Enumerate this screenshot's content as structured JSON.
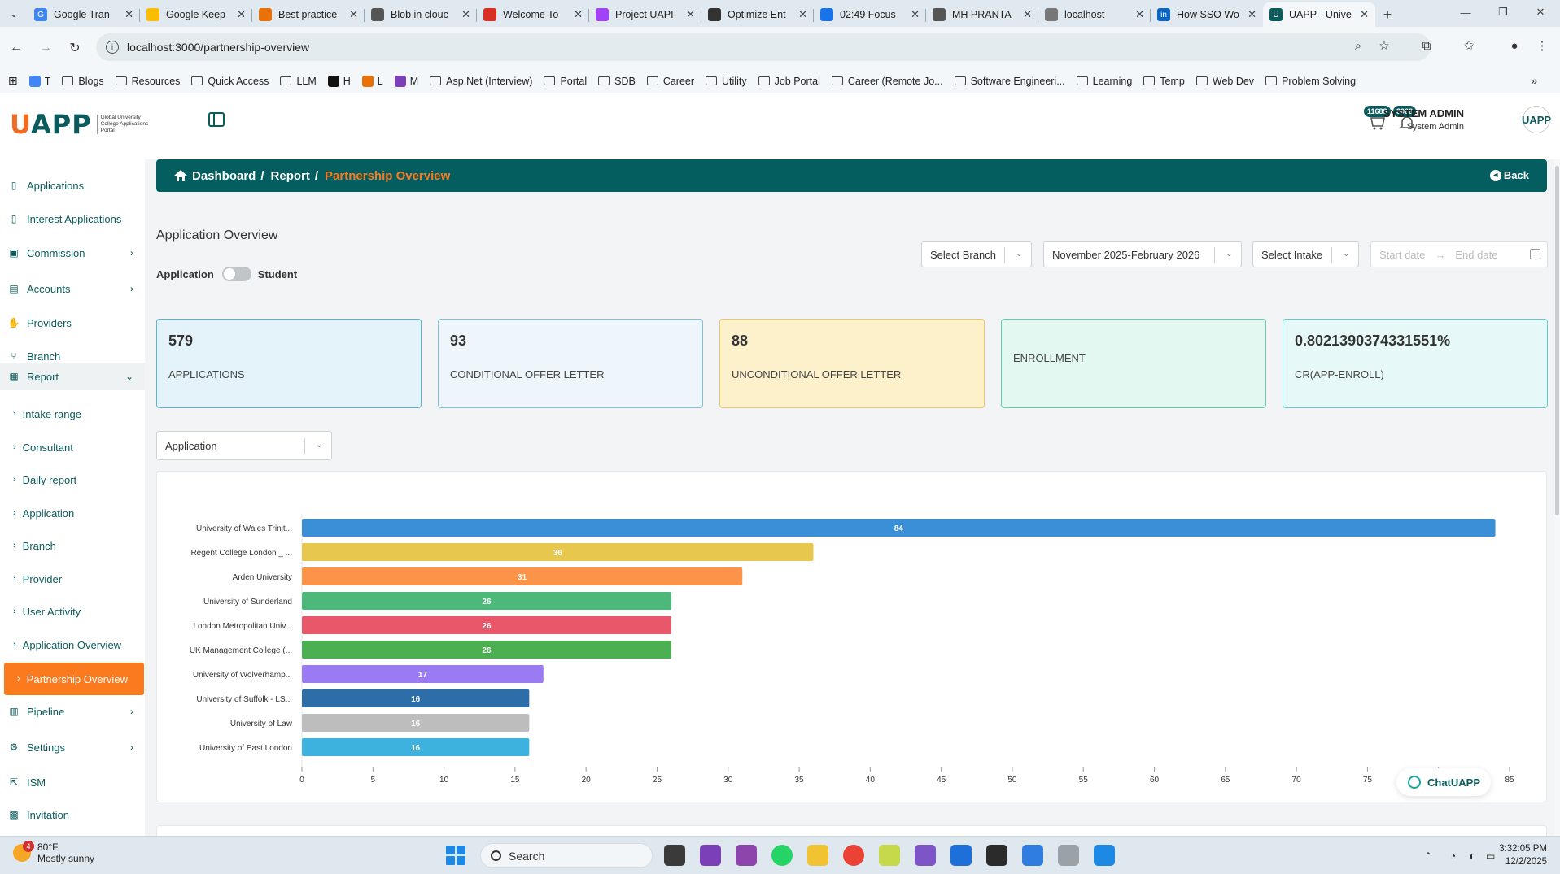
{
  "browser": {
    "tabs": [
      {
        "label": "Google Tran",
        "color": "#4285f4",
        "glyph": "G"
      },
      {
        "label": "Google Keep",
        "color": "#fbbc04",
        "glyph": ""
      },
      {
        "label": "Best practice",
        "color": "#e8710a",
        "glyph": ""
      },
      {
        "label": "Blob in clouc",
        "color": "#555555",
        "glyph": ""
      },
      {
        "label": "Welcome To",
        "color": "#d93025",
        "glyph": ""
      },
      {
        "label": "Project UAPI",
        "color": "#a142f4",
        "glyph": ""
      },
      {
        "label": "Optimize Ent",
        "color": "#333333",
        "glyph": ""
      },
      {
        "label": "02:49 Focus",
        "color": "#1a73e8",
        "glyph": ""
      },
      {
        "label": "MH PRANTA",
        "color": "#555555",
        "glyph": ""
      },
      {
        "label": "localhost",
        "color": "#777777",
        "glyph": ""
      },
      {
        "label": "How SSO Wo",
        "color": "#0a66c2",
        "glyph": "in"
      },
      {
        "label": "UAPP - Unive",
        "color": "#0b5b5c",
        "glyph": "U"
      }
    ],
    "url": "localhost:3000/partnership-overview",
    "bookmarks": [
      "T",
      "Blogs",
      "Resources",
      "Quick Access",
      "LLM",
      "H",
      "L",
      "M",
      "Asp.Net (Interview)",
      "Portal",
      "SDB",
      "Career",
      "Utility",
      "Job Portal",
      "Career (Remote Jo...",
      "Software Engineeri...",
      "Learning",
      "Temp",
      "Web Dev",
      "Problem Solving"
    ]
  },
  "header": {
    "logo": "UAPP",
    "logo_sub": "Global University College Applications Portal",
    "cart_badge": "11688",
    "notif_badge": "3068",
    "user_name": "SYSTEM ADMIN",
    "user_role": "System Admin",
    "avatar": "UAPP"
  },
  "sidebar": {
    "items": [
      {
        "label": "Applications",
        "icon": "file-icon"
      },
      {
        "label": "Interest Applications",
        "icon": "file-icon"
      },
      {
        "label": "Commission",
        "icon": "money-icon"
      },
      {
        "label": "Accounts",
        "icon": "card-icon"
      },
      {
        "label": "Providers",
        "icon": "handshake-icon"
      },
      {
        "label": "Branch",
        "icon": "branch-icon"
      },
      {
        "label": "Report",
        "icon": "report-icon"
      }
    ],
    "report_sub": [
      "Intake range",
      "Consultant",
      "Daily report",
      "Application",
      "Branch",
      "Provider",
      "User Activity",
      "Application Overview",
      "Partnership Overview"
    ],
    "bottom_items": [
      {
        "label": "Pipeline",
        "icon": "pipeline-icon"
      },
      {
        "label": "Settings",
        "icon": "settings-icon"
      },
      {
        "label": "ISM",
        "icon": "link-icon"
      },
      {
        "label": "Invitation",
        "icon": "invitation-icon"
      }
    ]
  },
  "breadcrumb": {
    "dashboard": "Dashboard",
    "report": "Report",
    "current": "Partnership Overview",
    "back": "Back"
  },
  "page": {
    "section_title": "Application Overview",
    "toggle_left": "Application",
    "toggle_right": "Student"
  },
  "filters": {
    "branch": "Select Branch",
    "date_range": "November 2025-February 2026",
    "intake": "Select Intake",
    "start_placeholder": "Start date",
    "end_placeholder": "End date"
  },
  "cards": [
    {
      "value": "579",
      "label": "APPLICATIONS",
      "bg": "#e3f3f9",
      "border": "#5ab3cc"
    },
    {
      "value": "93",
      "label": "CONDITIONAL OFFER LETTER",
      "bg": "#eef6fb",
      "border": "#7cc3d8"
    },
    {
      "value": "88",
      "label": "UNCONDITIONAL OFFER LETTER",
      "bg": "#fdf1cc",
      "border": "#e7c765"
    },
    {
      "value": "",
      "label": "ENROLLMENT",
      "bg": "#e3f8f1",
      "border": "#5fd1ab"
    },
    {
      "value": "0.8021390374331551%",
      "label": "CR(APP-ENROLL)",
      "bg": "#e6f9f8",
      "border": "#5ccfc7"
    }
  ],
  "chart_select": "Application",
  "chart_data": {
    "type": "bar",
    "orientation": "horizontal",
    "categories": [
      "University of Wales Trinit...",
      "Regent College London _ ...",
      "Arden University",
      "University of Sunderland",
      "London Metropolitan Univ...",
      "UK Management College (...",
      "University of Wolverhamp...",
      "University of Suffolk - LS...",
      "University of Law",
      "University of East London"
    ],
    "values": [
      84,
      36,
      31,
      26,
      26,
      26,
      17,
      16,
      16,
      16
    ],
    "colors": [
      "#3a8fd6",
      "#e8c74f",
      "#fb9349",
      "#4cb87a",
      "#e8586a",
      "#4cb053",
      "#9b7bf3",
      "#2e6ea8",
      "#bdbdbd",
      "#3eb2de"
    ],
    "xlim": [
      0,
      85
    ],
    "xticks": [
      0,
      5,
      10,
      15,
      20,
      25,
      30,
      35,
      40,
      45,
      50,
      55,
      60,
      65,
      70,
      75,
      80,
      85
    ]
  },
  "chat": {
    "label": "ChatUAPP"
  },
  "taskbar": {
    "temp": "80°F",
    "weather": "Mostly sunny",
    "weather_badge": "4",
    "search": "Search",
    "time": "3:32:05 PM",
    "date": "12/2/2025"
  }
}
